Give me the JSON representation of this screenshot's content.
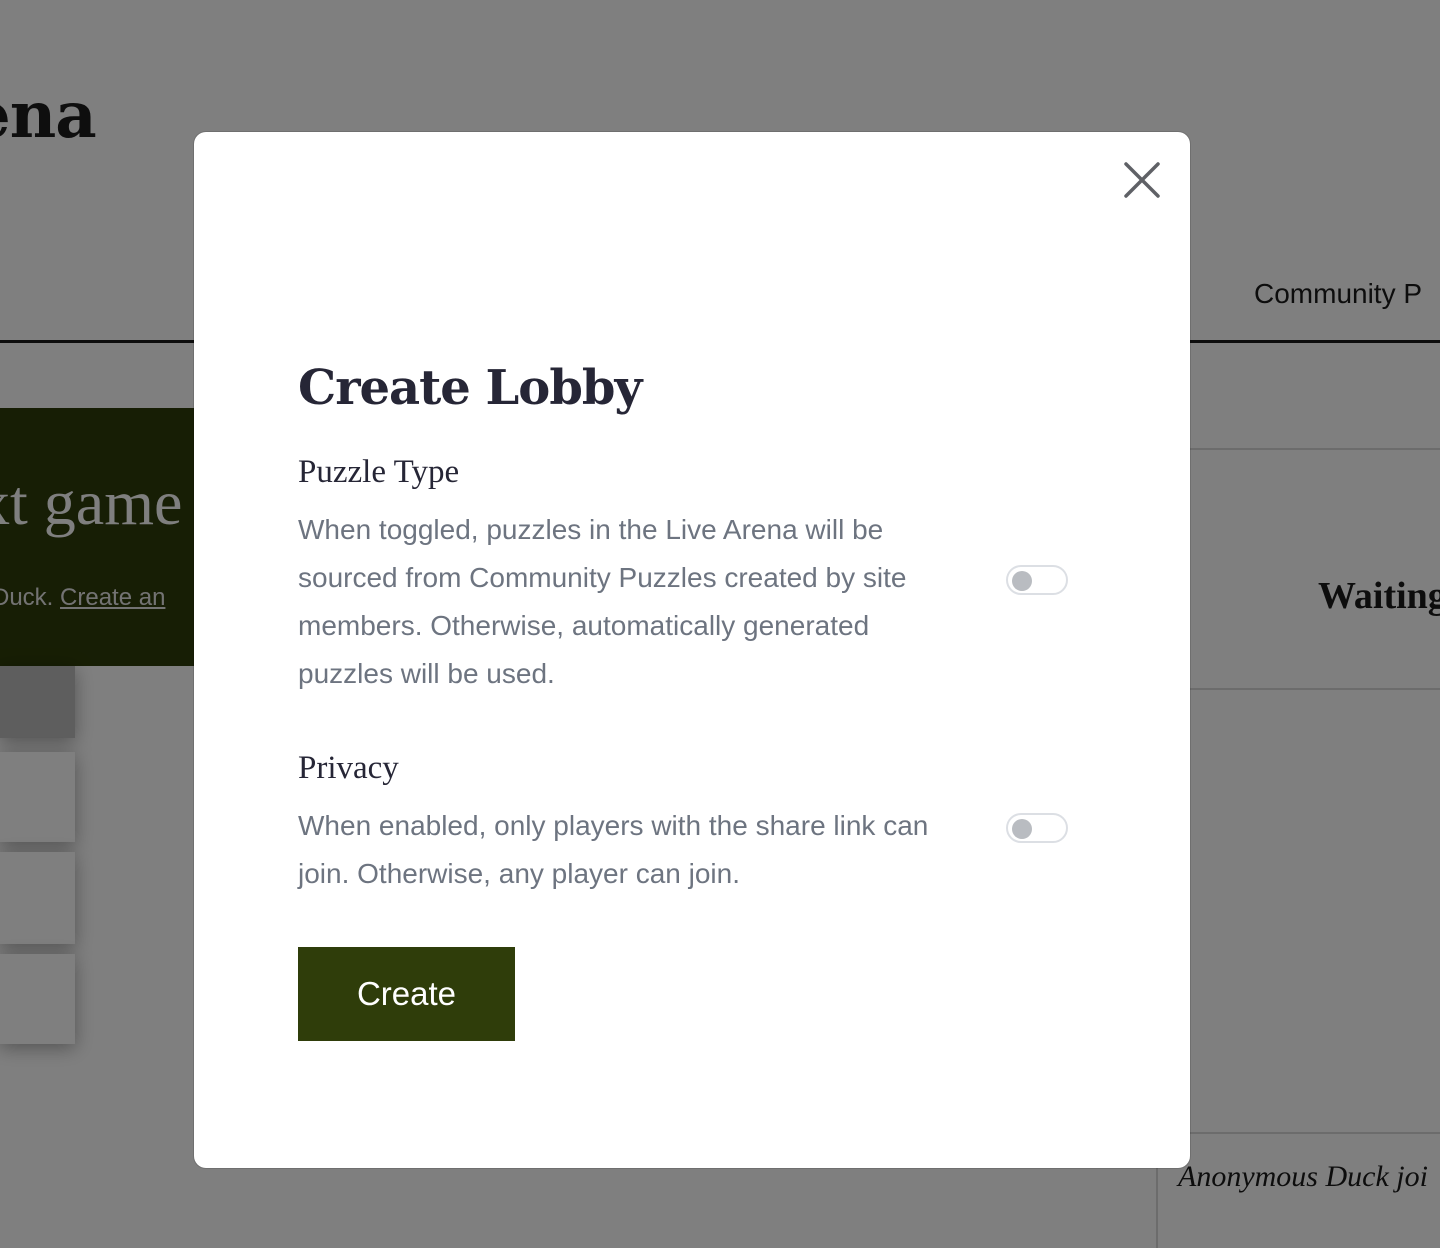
{
  "background": {
    "site_title": "ena",
    "nav_item": "Community P",
    "banner_title": "xt game",
    "banner_text": "Duck. ",
    "banner_link": "Create an",
    "waiting_label": "Waiting",
    "joined_message": "Anonymous Duck joi"
  },
  "modal": {
    "title": "Create Lobby",
    "close_icon": "close-icon",
    "sections": [
      {
        "label": "Puzzle Type",
        "description": "When toggled, puzzles in the Live Arena will be sourced from Community Puzzles created by site members. Otherwise, automatically generated puzzles will be used.",
        "toggle_on": false
      },
      {
        "label": "Privacy",
        "description": "When enabled, only players with the share link can join. Otherwise, any player can join.",
        "toggle_on": false
      }
    ],
    "create_label": "Create"
  },
  "colors": {
    "accent": "#2f3d0a",
    "overlay": "rgba(0,0,0,0.5)",
    "title_text": "#262636",
    "body_text": "#6d7480"
  }
}
